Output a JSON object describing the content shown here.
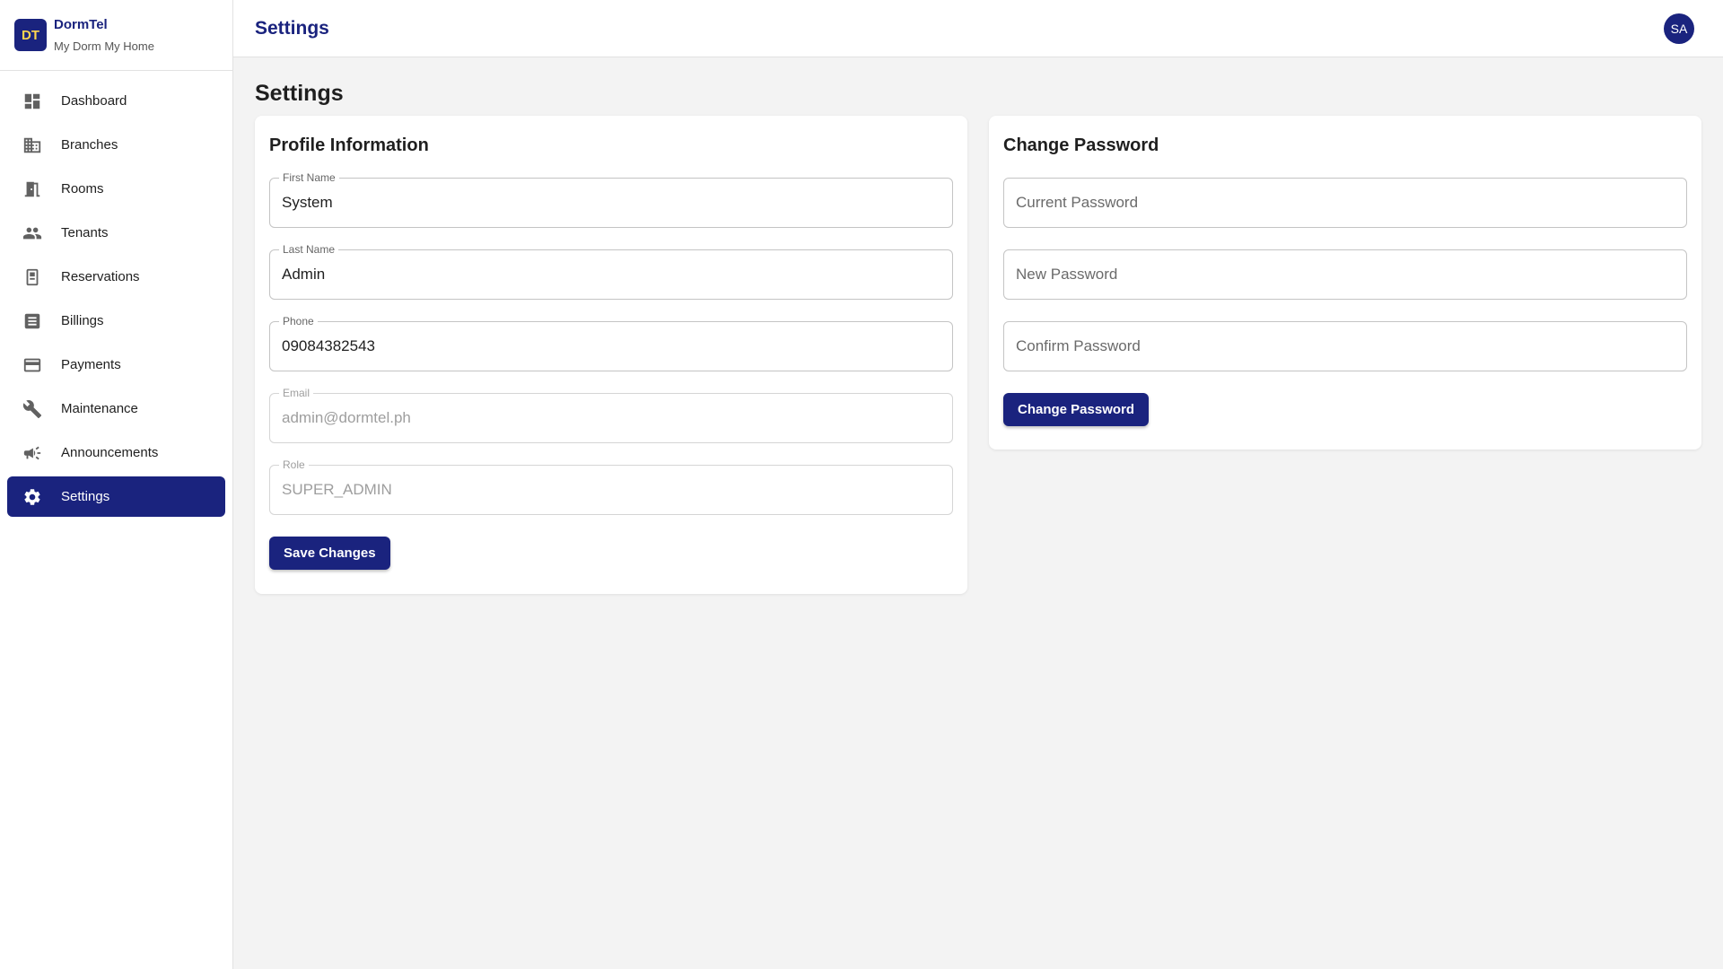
{
  "brand": {
    "logo_text": "DT",
    "name": "DormTel",
    "tagline": "My Dorm My Home"
  },
  "sidebar": {
    "items": [
      {
        "label": "Dashboard",
        "icon": "dashboard-icon"
      },
      {
        "label": "Branches",
        "icon": "building-icon"
      },
      {
        "label": "Rooms",
        "icon": "door-icon"
      },
      {
        "label": "Tenants",
        "icon": "people-icon"
      },
      {
        "label": "Reservations",
        "icon": "reservation-icon"
      },
      {
        "label": "Billings",
        "icon": "receipt-icon"
      },
      {
        "label": "Payments",
        "icon": "credit-card-icon"
      },
      {
        "label": "Maintenance",
        "icon": "wrench-icon"
      },
      {
        "label": "Announcements",
        "icon": "megaphone-icon"
      },
      {
        "label": "Settings",
        "icon": "gear-icon",
        "active": true
      }
    ]
  },
  "header": {
    "title": "Settings",
    "avatar_initials": "SA"
  },
  "main": {
    "title": "Settings",
    "profile": {
      "title": "Profile Information",
      "first_name": {
        "label": "First Name",
        "value": "System"
      },
      "last_name": {
        "label": "Last Name",
        "value": "Admin"
      },
      "phone": {
        "label": "Phone",
        "value": "09084382543"
      },
      "email": {
        "label": "Email",
        "value": "admin@dormtel.ph"
      },
      "role": {
        "label": "Role",
        "value": "SUPER_ADMIN"
      },
      "save_label": "Save Changes"
    },
    "password": {
      "title": "Change Password",
      "current_placeholder": "Current Password",
      "new_placeholder": "New Password",
      "confirm_placeholder": "Confirm Password",
      "submit_label": "Change Password"
    }
  },
  "colors": {
    "primary": "#1a237e",
    "logo_text": "#ffd54f",
    "background": "#f3f3f3"
  }
}
